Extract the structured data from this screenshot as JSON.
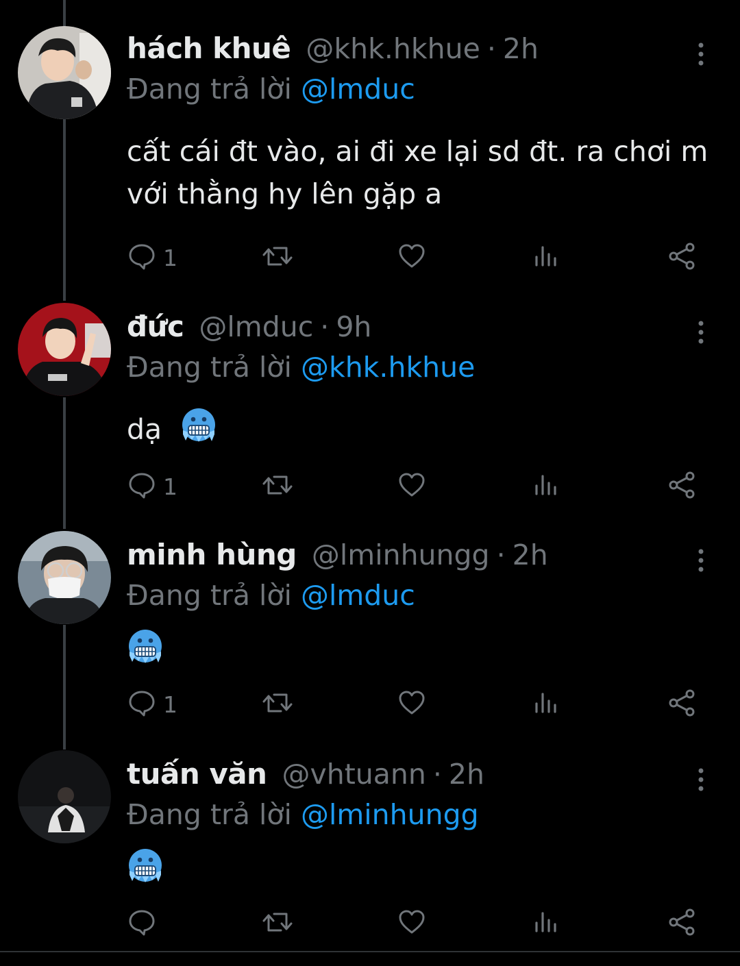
{
  "replying_prefix": "Đang trả lời",
  "colors": {
    "background": "#000000",
    "text": "#e7e9ea",
    "muted": "#71767b",
    "mention": "#1d9bf0"
  },
  "tweets": [
    {
      "name": "hách khuê",
      "handle": "@khk.hkhue",
      "separator": "·",
      "time": "2h",
      "replying_to": "@lmduc",
      "text": "cất cái đt vào, ai đi xe lại sd đt. ra chơi m với thằng hy lên gặp a",
      "emoji": "",
      "reply_count": "1",
      "avatar_icon": "avatar-photo"
    },
    {
      "name": "đức",
      "handle": "@lmduc",
      "separator": "·",
      "time": "9h",
      "replying_to": "@khk.hkhue",
      "text": "dạ",
      "emoji": "cold-face",
      "reply_count": "1",
      "avatar_icon": "avatar-photo"
    },
    {
      "name": "minh hùng",
      "handle": "@lminhungg",
      "separator": "·",
      "time": "2h",
      "replying_to": "@lmduc",
      "text": "",
      "emoji": "cold-face",
      "reply_count": "1",
      "avatar_icon": "avatar-photo"
    },
    {
      "name": "tuấn văn",
      "handle": "@vhtuann",
      "separator": "·",
      "time": "2h",
      "replying_to": "@lminhungg",
      "text": "",
      "emoji": "cold-face",
      "reply_count": "",
      "avatar_icon": "avatar-photo"
    }
  ]
}
